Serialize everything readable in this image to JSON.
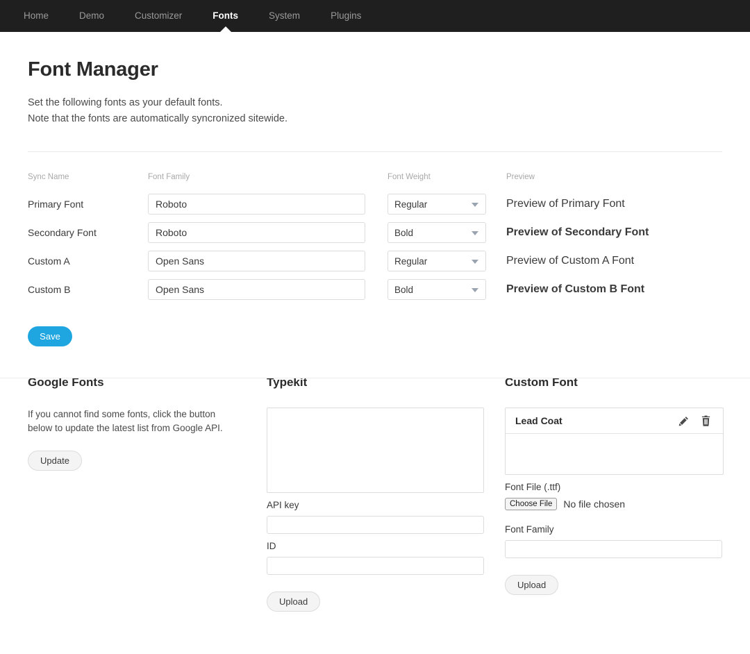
{
  "nav": {
    "items": [
      {
        "label": "Home",
        "active": false
      },
      {
        "label": "Demo",
        "active": false
      },
      {
        "label": "Customizer",
        "active": false
      },
      {
        "label": "Fonts",
        "active": true
      },
      {
        "label": "System",
        "active": false
      },
      {
        "label": "Plugins",
        "active": false
      }
    ]
  },
  "header": {
    "title": "Font Manager",
    "desc_line1": "Set the following fonts as your default fonts.",
    "desc_line2": "Note that the fonts are automatically syncronized sitewide."
  },
  "font_table": {
    "columns": {
      "sync_name": "Sync Name",
      "font_family": "Font Family",
      "font_weight": "Font Weight",
      "preview": "Preview"
    },
    "weight_options": [
      "Regular",
      "Bold"
    ],
    "rows": [
      {
        "sync_name": "Primary Font",
        "font_family": "Roboto",
        "font_weight": "Regular",
        "preview": "Preview of Primary Font"
      },
      {
        "sync_name": "Secondary Font",
        "font_family": "Roboto",
        "font_weight": "Bold",
        "preview": "Preview of Secondary Font"
      },
      {
        "sync_name": "Custom A",
        "font_family": "Open Sans",
        "font_weight": "Regular",
        "preview": "Preview of Custom A Font"
      },
      {
        "sync_name": "Custom B",
        "font_family": "Open Sans",
        "font_weight": "Bold",
        "preview": "Preview of Custom B Font"
      }
    ]
  },
  "save_button": {
    "label": "Save",
    "color": "#1fa6e0"
  },
  "google_fonts": {
    "title": "Google Fonts",
    "desc": "If you cannot find some fonts, click the button below to update the latest list from Google API.",
    "update_label": "Update"
  },
  "typekit": {
    "title": "Typekit",
    "list_items": [],
    "api_key_label": "API key",
    "api_key_value": "",
    "id_label": "ID",
    "id_value": "",
    "upload_label": "Upload"
  },
  "custom_font": {
    "title": "Custom Font",
    "entries": [
      {
        "name": "Lead Coat",
        "edit_icon": "pencil-icon",
        "delete_icon": "trash-icon"
      }
    ],
    "font_file_label": "Font File (.ttf)",
    "choose_file_label": "Choose File",
    "file_status": "No file chosen",
    "font_family_label": "Font Family",
    "font_family_value": "",
    "upload_label": "Upload"
  }
}
